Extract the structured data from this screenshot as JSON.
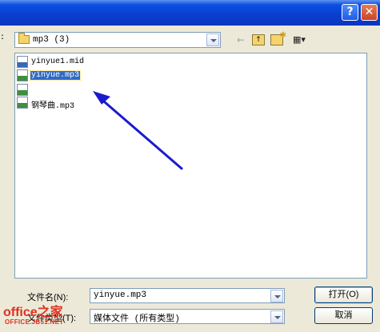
{
  "titlebar": {
    "help_label": "?",
    "close_label": "✕"
  },
  "lookin": {
    "label": ":",
    "value": "mp3 (3)"
  },
  "toolbar": {
    "back_icon": "←",
    "view_icon": "▦▾"
  },
  "files": [
    {
      "name": "yinyue1.mid",
      "type": "mid",
      "selected": false
    },
    {
      "name": "yinyue.mp3",
      "type": "mp3",
      "selected": true
    },
    {
      "name": "",
      "type": "mp3",
      "selected": false
    },
    {
      "name": "钢琴曲.mp3",
      "type": "mp3",
      "selected": false
    }
  ],
  "filename": {
    "label": "文件名(N):",
    "value": "yinyue.mp3"
  },
  "filetype": {
    "label": "文件类型(T):",
    "value": "媒体文件 (所有类型)"
  },
  "buttons": {
    "open": "打开(O)",
    "cancel": "取消"
  },
  "watermark": {
    "brand": "office之家",
    "url": "OFFICE.JB51.NET"
  },
  "colors": {
    "title_blue": "#0a3fd0",
    "selection": "#316ac5",
    "arrow": "#1a1ad0",
    "watermark": "#e03020"
  }
}
